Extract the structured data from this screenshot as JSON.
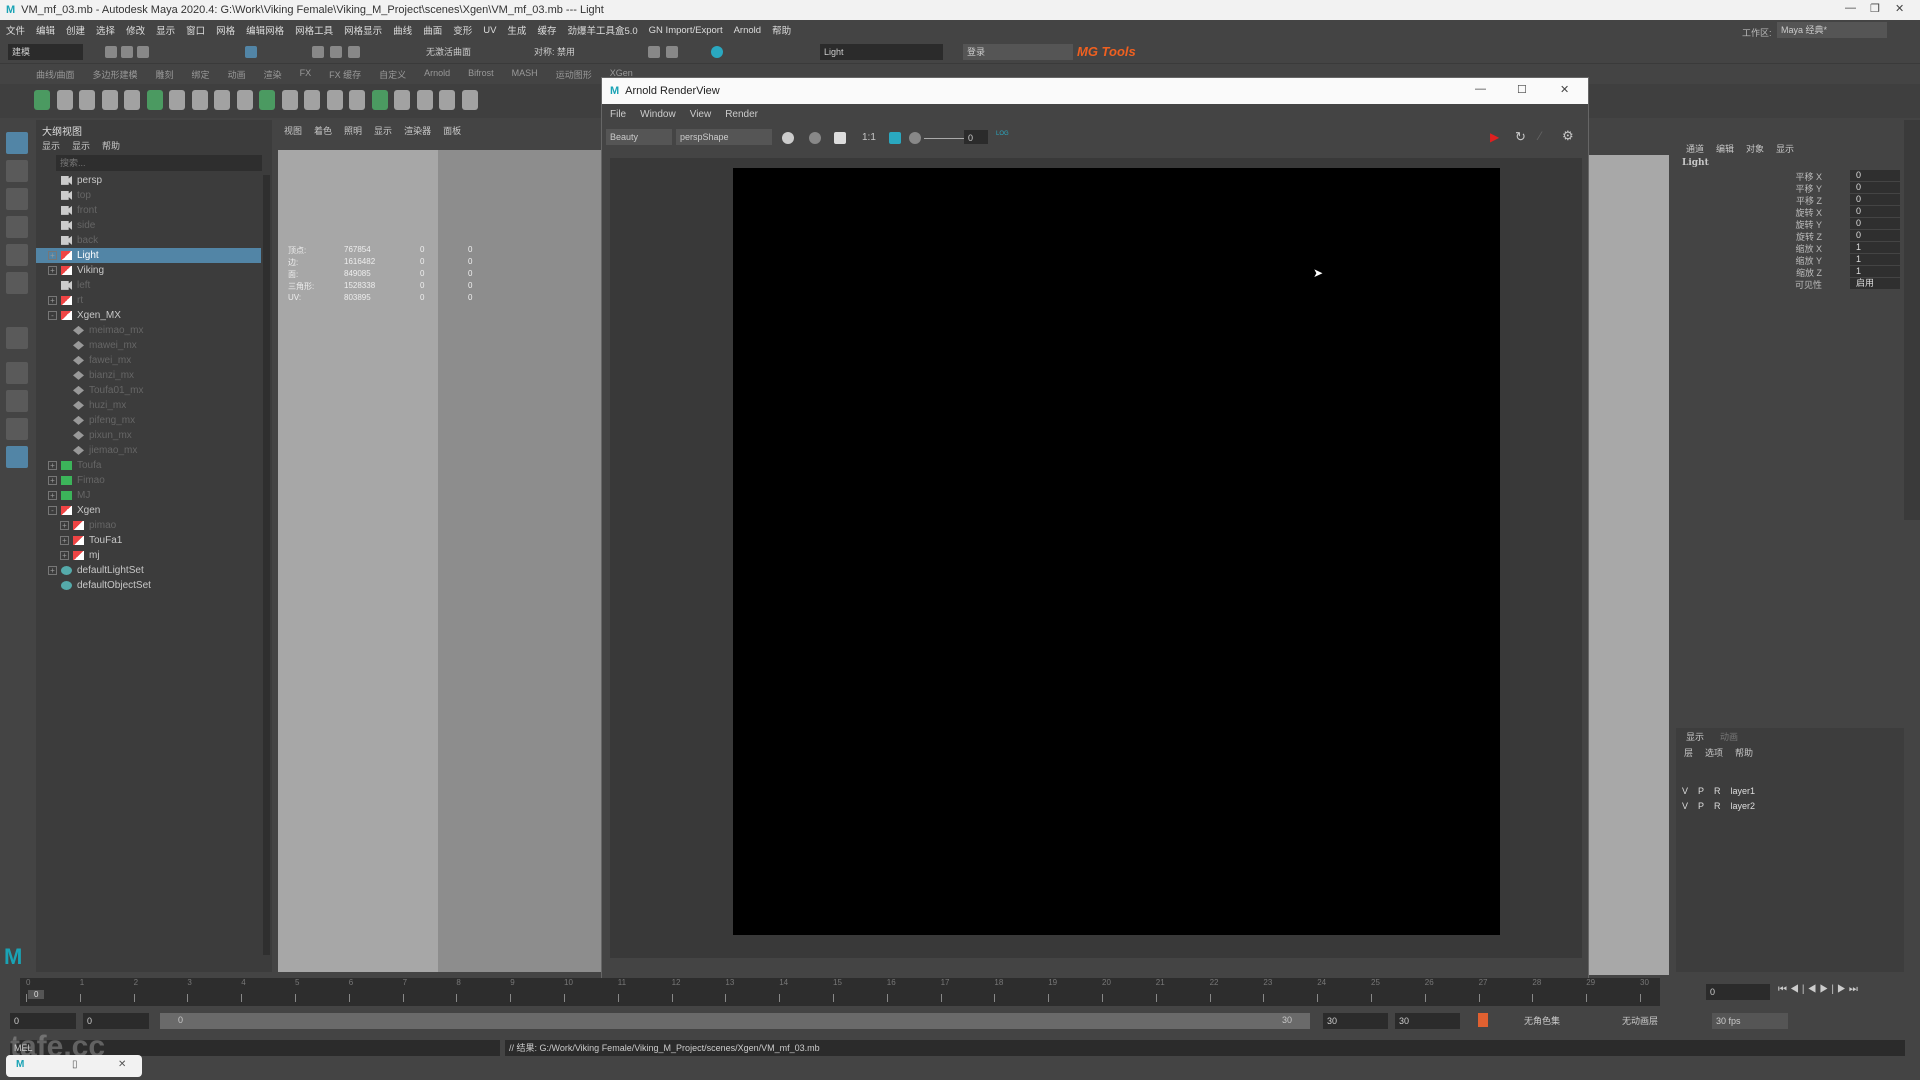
{
  "window": {
    "title": "VM_mf_03.mb - Autodesk Maya 2020.4: G:\\Work\\Viking Female\\Viking_M_Project\\scenes\\Xgen\\VM_mf_03.mb  ---  Light",
    "logo": "M"
  },
  "menu": [
    "文件",
    "编辑",
    "创建",
    "选择",
    "修改",
    "显示",
    "窗口",
    "网格",
    "编辑网格",
    "网格工具",
    "网格显示",
    "曲线",
    "曲面",
    "变形",
    "UV",
    "生成",
    "缓存",
    "劲爆羊工具盒5.0",
    "GN Import/Export",
    "Arnold",
    "帮助"
  ],
  "status": {
    "mode": "建模",
    "live_surface": "无激活曲面",
    "symmetry": "对称: 禁用",
    "search_value": "Light",
    "login": "登录",
    "mg_tools": "MG Tools",
    "workspace_label": "工作区:",
    "workspace": "Maya 经典*"
  },
  "shelf_tabs": [
    "曲线/曲面",
    "多边形建模",
    "雕刻",
    "绑定",
    "动画",
    "渲染",
    "FX",
    "FX 缓存",
    "自定义",
    "Arnold",
    "Bifrost",
    "MASH",
    "运动图形",
    "XGen"
  ],
  "outliner": {
    "title": "大纲视图",
    "menu": [
      "显示",
      "显示",
      "帮助"
    ],
    "search_placeholder": "搜索...",
    "items": [
      {
        "label": "persp",
        "icon": "camera",
        "dim": false,
        "expander": ""
      },
      {
        "label": "top",
        "icon": "camera",
        "dim": true,
        "expander": ""
      },
      {
        "label": "front",
        "icon": "camera",
        "dim": true,
        "expander": ""
      },
      {
        "label": "side",
        "icon": "camera",
        "dim": true,
        "expander": ""
      },
      {
        "label": "back",
        "icon": "camera",
        "dim": true,
        "expander": ""
      },
      {
        "label": "Light",
        "icon": "group",
        "dim": false,
        "expander": "+",
        "selected": true
      },
      {
        "label": "Viking",
        "icon": "group",
        "dim": false,
        "expander": "+"
      },
      {
        "label": "left",
        "icon": "camera",
        "dim": true,
        "expander": ""
      },
      {
        "label": "rt",
        "icon": "group",
        "dim": true,
        "expander": "+"
      },
      {
        "label": "Xgen_MX",
        "icon": "group",
        "dim": false,
        "expander": "-"
      },
      {
        "label": "meimao_mx",
        "icon": "description",
        "dim": true,
        "indent": 1
      },
      {
        "label": "mawei_mx",
        "icon": "description",
        "dim": true,
        "indent": 1
      },
      {
        "label": "fawei_mx",
        "icon": "description",
        "dim": true,
        "indent": 1
      },
      {
        "label": "bianzi_mx",
        "icon": "description",
        "dim": true,
        "indent": 1
      },
      {
        "label": "Toufa01_mx",
        "icon": "description",
        "dim": true,
        "indent": 1
      },
      {
        "label": "huzi_mx",
        "icon": "description",
        "dim": true,
        "indent": 1
      },
      {
        "label": "pifeng_mx",
        "icon": "description",
        "dim": true,
        "indent": 1
      },
      {
        "label": "pixun_mx",
        "icon": "description",
        "dim": true,
        "indent": 1
      },
      {
        "label": "jiemao_mx",
        "icon": "description",
        "dim": true,
        "indent": 1
      },
      {
        "label": "Toufa",
        "icon": "xgen",
        "dim": true,
        "expander": "+"
      },
      {
        "label": "Fimao",
        "icon": "xgen",
        "dim": true,
        "expander": "+"
      },
      {
        "label": "MJ",
        "icon": "xgen",
        "dim": true,
        "expander": "+"
      },
      {
        "label": "Xgen",
        "icon": "group",
        "dim": false,
        "expander": "-"
      },
      {
        "label": "pimao",
        "icon": "group",
        "dim": true,
        "indent": 1,
        "expander": "+"
      },
      {
        "label": "TouFa1",
        "icon": "group",
        "dim": false,
        "indent": 1,
        "expander": "+"
      },
      {
        "label": "mj",
        "icon": "group",
        "dim": false,
        "indent": 1,
        "expander": "+"
      },
      {
        "label": "defaultLightSet",
        "icon": "set",
        "dim": false,
        "expander": "+"
      },
      {
        "label": "defaultObjectSet",
        "icon": "set",
        "dim": false,
        "expander": ""
      }
    ]
  },
  "viewport": {
    "menu": [
      "视图",
      "着色",
      "照明",
      "显示",
      "渲染器",
      "面板"
    ],
    "stats": [
      {
        "label": "顶点:",
        "v": "767854",
        "a": "0",
        "b": "0"
      },
      {
        "label": "边:",
        "v": "1616482",
        "a": "0",
        "b": "0"
      },
      {
        "label": "面:",
        "v": "849085",
        "a": "0",
        "b": "0"
      },
      {
        "label": "三角形:",
        "v": "1528338",
        "a": "0",
        "b": "0"
      },
      {
        "label": "UV:",
        "v": "803895",
        "a": "0",
        "b": "0"
      }
    ]
  },
  "arnold": {
    "title": "Arnold RenderView",
    "menu": [
      "File",
      "Window",
      "View",
      "Render"
    ],
    "aov": "Beauty",
    "camera": "perspShape",
    "ratio": "1:1",
    "exposure": "0",
    "log": "LOG"
  },
  "channel_box": {
    "menu": [
      "通道",
      "编辑",
      "对象",
      "显示"
    ],
    "object": "Light",
    "rows": [
      {
        "label": "平移 X",
        "value": "0"
      },
      {
        "label": "平移 Y",
        "value": "0"
      },
      {
        "label": "平移 Z",
        "value": "0"
      },
      {
        "label": "旋转 X",
        "value": "0"
      },
      {
        "label": "旋转 Y",
        "value": "0"
      },
      {
        "label": "旋转 Z",
        "value": "0"
      },
      {
        "label": "缩放 X",
        "value": "1"
      },
      {
        "label": "缩放 Y",
        "value": "1"
      },
      {
        "label": "缩放 Z",
        "value": "1"
      },
      {
        "label": "可见性",
        "value": "启用"
      }
    ]
  },
  "layers": {
    "tabs": [
      "显示",
      "动画"
    ],
    "menu": [
      "层",
      "选项",
      "帮助"
    ],
    "rows": [
      {
        "v": "V",
        "p": "P",
        "r": "R",
        "name": "layer1"
      },
      {
        "v": "V",
        "p": "P",
        "r": "R",
        "name": "layer2"
      }
    ]
  },
  "timeline": {
    "ticks": [
      "0",
      "1",
      "2",
      "3",
      "4",
      "5",
      "6",
      "7",
      "8",
      "9",
      "10",
      "11",
      "12",
      "13",
      "14",
      "15",
      "16",
      "17",
      "18",
      "19",
      "20",
      "21",
      "22",
      "23",
      "24",
      "25",
      "26",
      "27",
      "28",
      "29",
      "30"
    ],
    "current": "0",
    "current_field": "0"
  },
  "range": {
    "start": "0",
    "anim_start": "0",
    "slider_start": "0",
    "slider_end": "30",
    "end": "30",
    "anim_end": "30",
    "char_set": "无角色集",
    "anim_layer": "无动画层",
    "fps": "30 fps"
  },
  "command": {
    "lang": "MEL",
    "result": "// 结果: G:/Work/Viking Female/Viking_M_Project/scenes/Xgen/VM_mf_03.mb"
  },
  "watermark": "tafe.cc"
}
